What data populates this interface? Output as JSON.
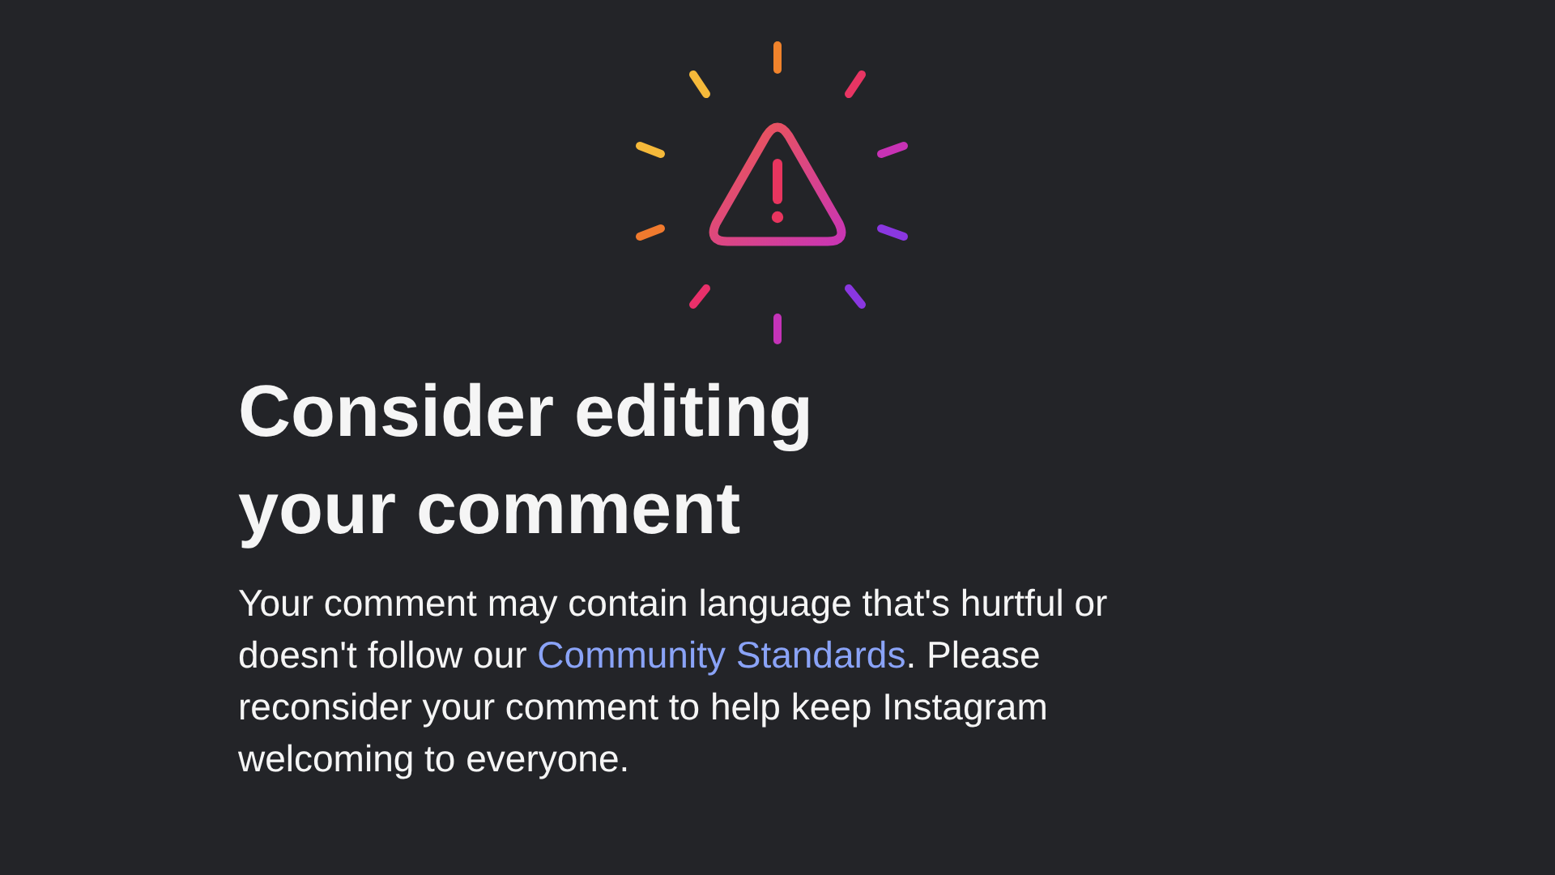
{
  "title": "Consider editing your comment",
  "message": {
    "text_before": "Your comment may contain language that's hurtful or doesn't follow our",
    "link": "Community Standards",
    "text_after": ". Please reconsider your comment to help keep Instagram welcoming to everyone."
  }
}
